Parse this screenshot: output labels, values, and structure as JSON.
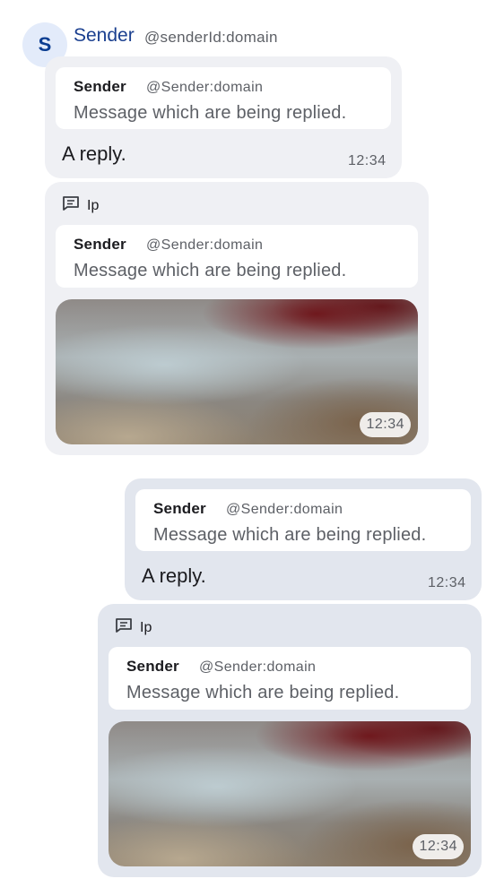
{
  "header": {
    "avatar_letter": "S",
    "sender_name": "Sender",
    "sender_id": "@senderId:domain"
  },
  "messages": [
    {
      "direction": "incoming",
      "reply_to": {
        "sender": "Sender",
        "sender_id": "@Sender:domain",
        "text": "Message which are being replied."
      },
      "text": "A reply.",
      "time": "12:34"
    },
    {
      "direction": "incoming",
      "thread_label": "Ip",
      "thread_icon": "thread-icon",
      "reply_to": {
        "sender": "Sender",
        "sender_id": "@Sender:domain",
        "text": "Message which are being replied."
      },
      "image": "blurred-image",
      "time": "12:34"
    },
    {
      "direction": "outgoing",
      "reply_to": {
        "sender": "Sender",
        "sender_id": "@Sender:domain",
        "text": "Message which are being replied."
      },
      "text": "A reply.",
      "time": "12:34"
    },
    {
      "direction": "outgoing",
      "thread_label": "Ip",
      "thread_icon": "thread-icon",
      "reply_to": {
        "sender": "Sender",
        "sender_id": "@Sender:domain",
        "text": "Message which are being replied."
      },
      "image": "blurred-image",
      "time": "12:34"
    }
  ],
  "colors": {
    "incoming_bubble": "#eff0f4",
    "outgoing_bubble": "#e2e6ee",
    "sender_name": "#1a3f8f",
    "avatar_bg": "#e3ebfa",
    "secondary_text": "#5d6066"
  }
}
